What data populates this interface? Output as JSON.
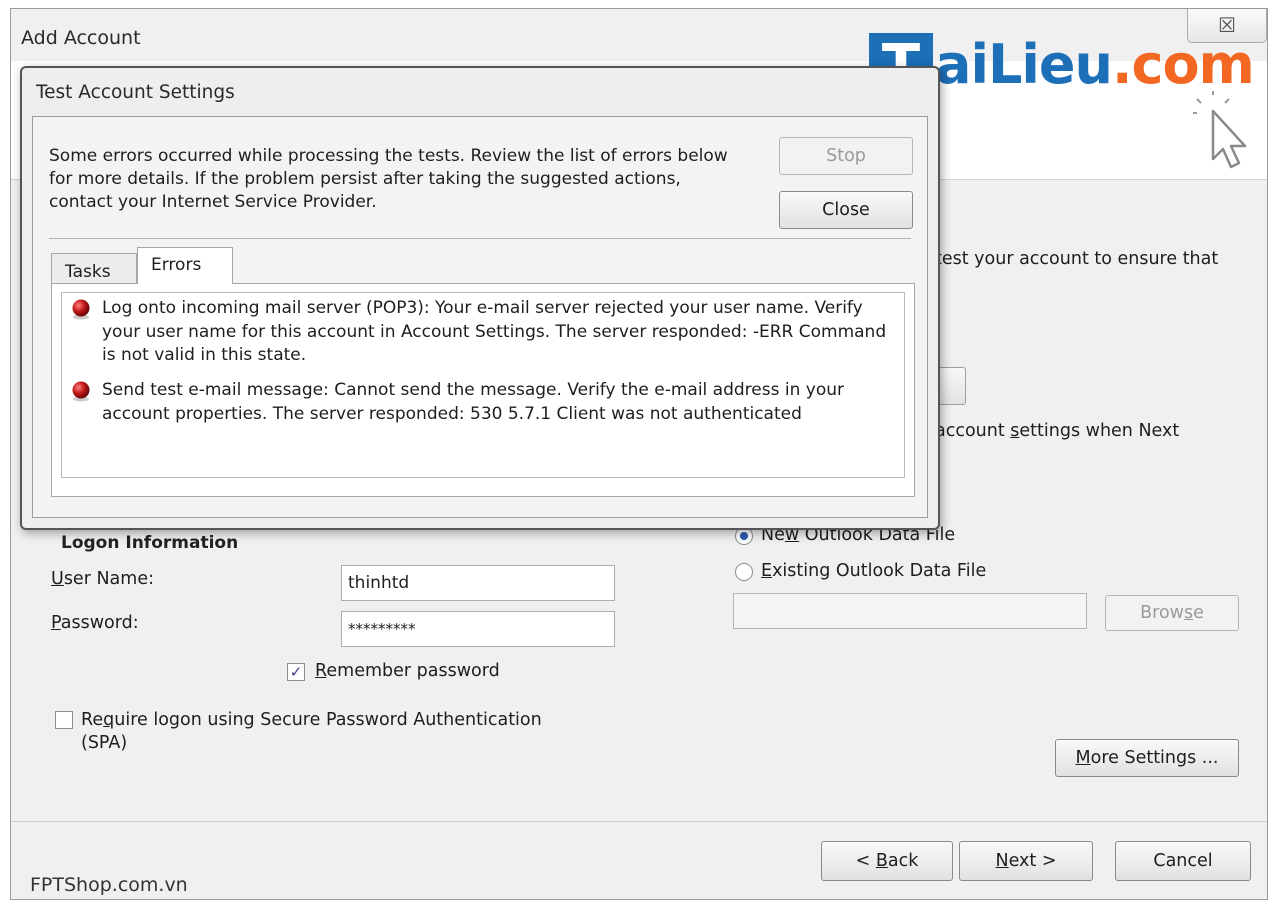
{
  "outer_window": {
    "title": "Add Account",
    "close_glyph": "☒"
  },
  "logo": {
    "box_letter": "T",
    "part_blue": "aiLieu",
    "part_orange": ".com"
  },
  "background": {
    "test_text": "test your account to ensure that",
    "settings_text_prefix": "account ",
    "settings_text_underline": "s",
    "settings_text_suffix": "ettings when Next"
  },
  "logon": {
    "section_title": "Logon Information",
    "username_label_u": "U",
    "username_label_rest": "ser Name:",
    "username_value": "thinhtd",
    "password_label_u": "P",
    "password_label_rest": "assword:",
    "password_value": "*********",
    "remember_label_u": "R",
    "remember_label_rest": "emember password",
    "remember_checked": true,
    "spa_label_prefix": "Re",
    "spa_label_u": "q",
    "spa_label_line1": "uire logon using Secure Password Authentication",
    "spa_label_line2": "(SPA)",
    "spa_checked": false
  },
  "data_file": {
    "new_label_prefix": "Ne",
    "new_label_u": "w",
    "new_label_rest": " Outlook Data File",
    "existing_label_u": "E",
    "existing_label_rest": "xisting Outlook Data File",
    "selected": "new",
    "path_value": "",
    "browse_prefix": "Brow",
    "browse_u": "s",
    "browse_rest": "e"
  },
  "buttons": {
    "more_settings_u": "M",
    "more_settings_rest": "ore Settings ...",
    "back_prefix": "< ",
    "back_u": "B",
    "back_rest": "ack",
    "next_u": "N",
    "next_rest": "ext >",
    "cancel": "Cancel"
  },
  "dialog": {
    "title": "Test Account Settings",
    "message": "Some errors occurred while processing the tests. Review the list of errors below for more details. If the problem persist after taking the suggested actions, contact your Internet Service Provider.",
    "stop_label": "Stop",
    "close_label": "Close",
    "tabs": [
      "Tasks",
      "Errors"
    ],
    "active_tab": "Errors",
    "errors": [
      "Log onto incoming mail server (POP3): Your e-mail server rejected your user name. Verify your user name for this account in Account Settings.  The server responded: -ERR Command is not valid in this state.",
      "Send test e-mail message: Cannot send the message. Verify the e-mail address in your account properties.  The server responded: 530 5.7.1 Client was not authenticated"
    ],
    "error_icon": "error-ball-icon"
  },
  "watermark": "FPTShop.com.vn",
  "colors": {
    "logo_blue": "#1d6fb8",
    "logo_orange": "#f26722",
    "error_red": "#b51414"
  }
}
